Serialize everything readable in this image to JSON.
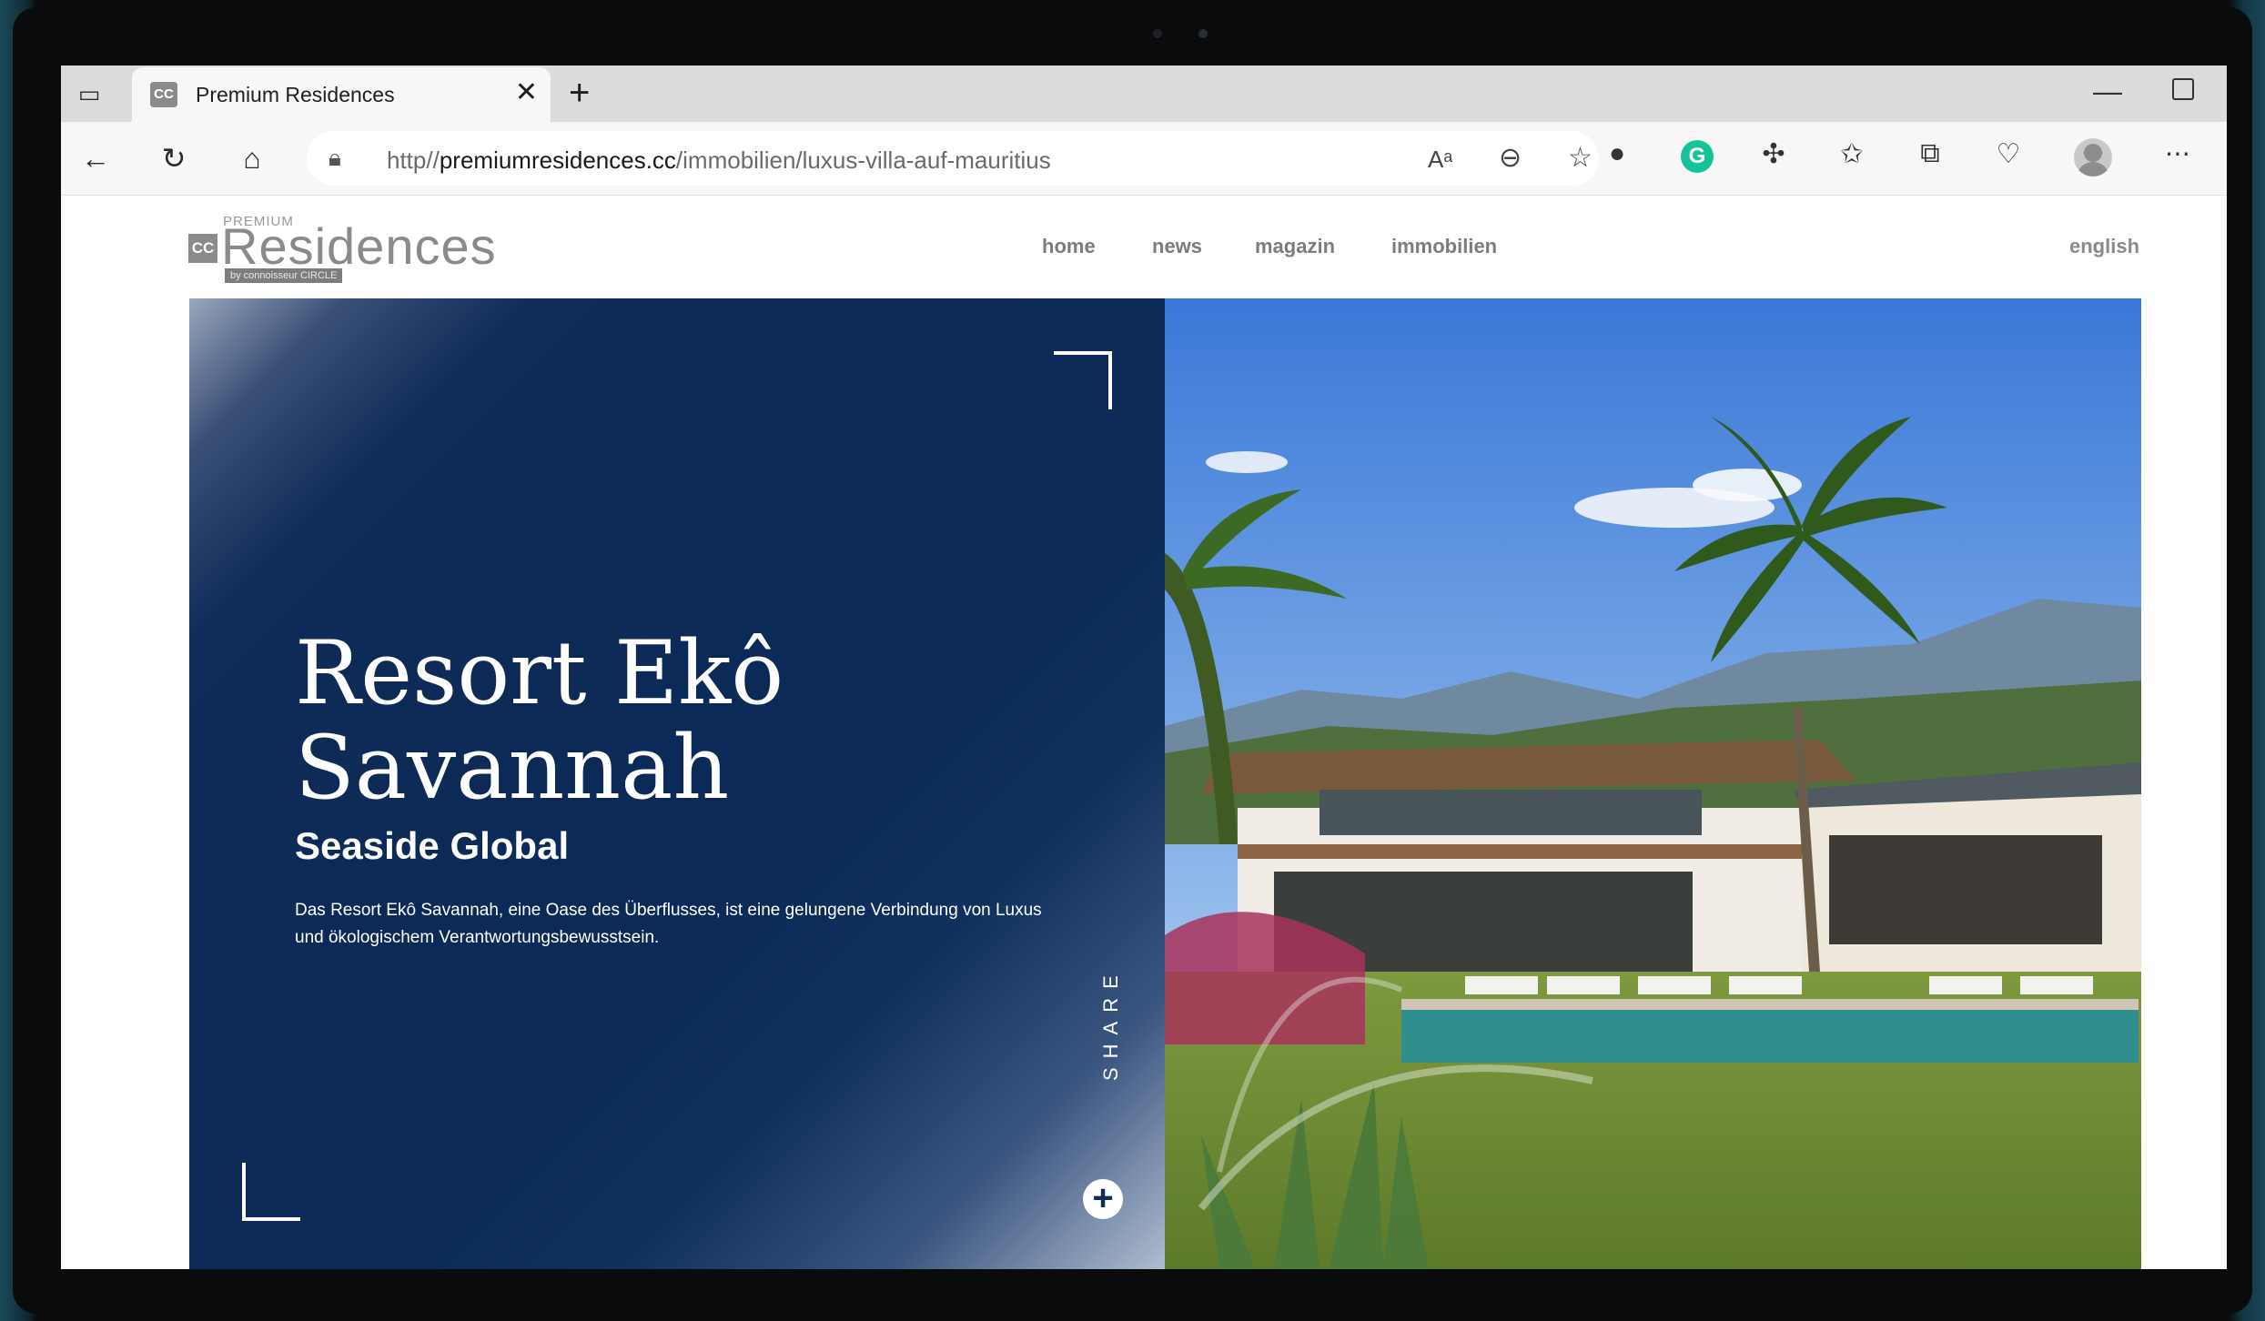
{
  "browser": {
    "tab_title": "Premium Residences",
    "favicon_text": "CC",
    "tab_close": "✕",
    "new_tab": "+",
    "url_scheme": "http",
    "url_gap": "//",
    "url_host": "premiumresidences.cc",
    "url_path": "/immobilien/luxus-villa-auf-mauritius",
    "read_aloud": "Aᵃ",
    "grammarly_letter": "G"
  },
  "site": {
    "logo_premium": "PREMIUM",
    "logo_word": "Residences",
    "logo_sub": "by connoisseur CIRCLE",
    "logo_cc": "CC",
    "nav": [
      "home",
      "news",
      "magazin",
      "immobilien"
    ],
    "lang": "english"
  },
  "hero": {
    "title_line1": "Resort Ekô",
    "title_line2": "Savannah",
    "subtitle": "Seaside Global",
    "description": "Das Resort Ekô Savannah, eine Oase des Überflusses, ist eine gelungene Verbindung von Luxus und ökologischem Verantwortungsbewusstsein.",
    "share_label": "SHARE",
    "share_icon": "+",
    "colors": {
      "panel": "#0b2a57",
      "text": "#ffffff"
    }
  }
}
